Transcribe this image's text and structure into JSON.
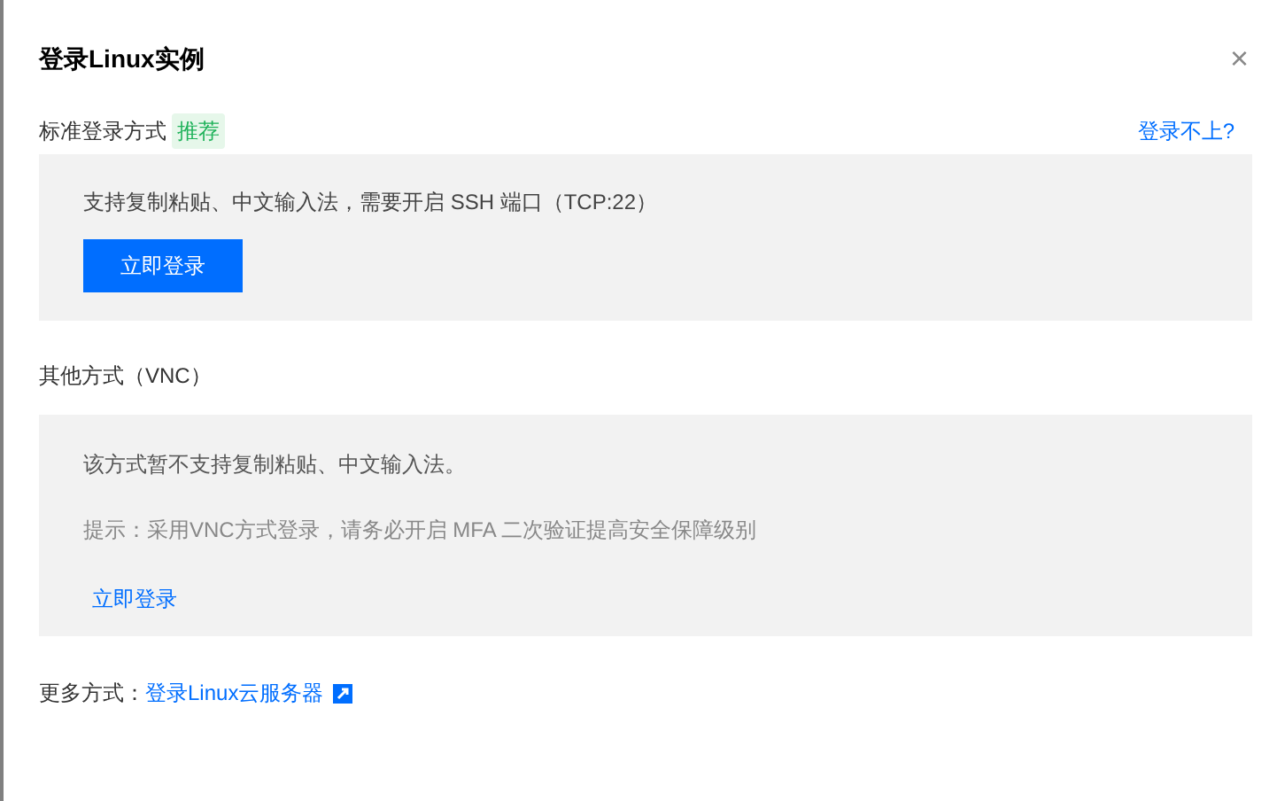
{
  "dialog": {
    "title": "登录Linux实例",
    "close": "×"
  },
  "standard": {
    "label": "标准登录方式",
    "badge": "推荐",
    "help_link": "登录不上?",
    "description": "支持复制粘贴、中文输入法，需要开启 SSH 端口（TCP:22）",
    "button": "立即登录"
  },
  "other": {
    "label": "其他方式（VNC）",
    "description": "该方式暂不支持复制粘贴、中文输入法。",
    "hint": "提示：采用VNC方式登录，请务必开启 MFA 二次验证提高安全保障级别",
    "link": "立即登录"
  },
  "more": {
    "label": "更多方式：",
    "link": "登录Linux云服务器"
  }
}
